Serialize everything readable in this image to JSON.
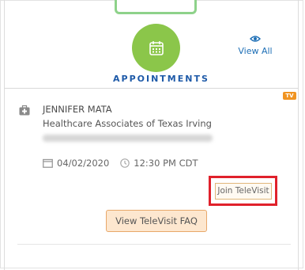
{
  "widget": {
    "title": "APPOINTMENTS",
    "view_all_label": "View All"
  },
  "appointment": {
    "badge": "TV",
    "provider_name": "JENNIFER MATA",
    "practice": "Healthcare Associates of Texas Irving",
    "date": "04/02/2020",
    "time": "12:30 PM CDT",
    "join_label": "Join TeleVisit",
    "faq_label": "View TeleVisit FAQ"
  },
  "colors": {
    "accent_green": "#8bc64a",
    "title_blue": "#1e5aa8",
    "link_blue": "#1e6fb6",
    "highlight_red": "#e0212b",
    "tv_badge_orange": "#f09422",
    "faq_button_bg": "#fde7cf"
  },
  "icons": {
    "calendar": "calendar-icon",
    "view_all": "eye-icon",
    "provider": "medical-bag-icon",
    "date": "calendar-small-icon",
    "time": "clock-icon"
  }
}
